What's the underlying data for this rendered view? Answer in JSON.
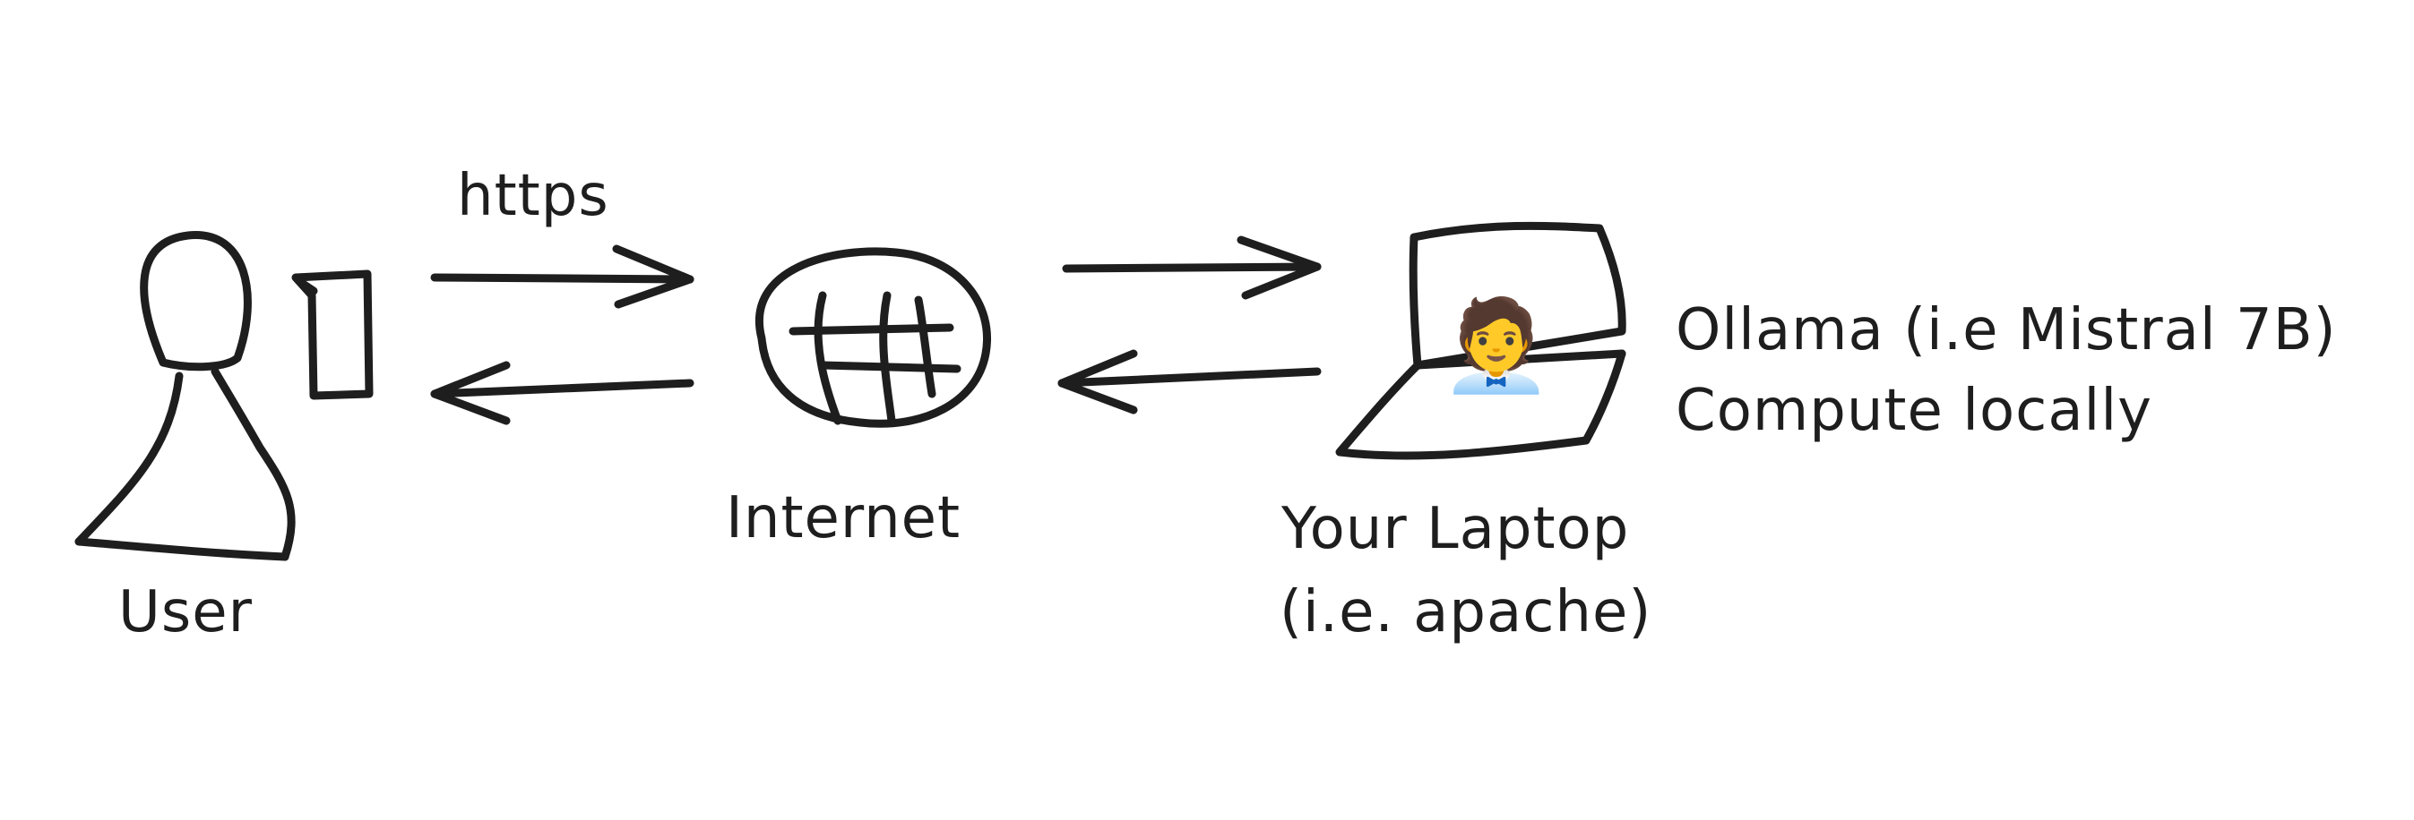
{
  "labels": {
    "protocol": "https",
    "user": "User",
    "internet": "Internet",
    "laptop_line1": "Your Laptop",
    "laptop_line2": "(i.e. apache)",
    "compute_line1": "Ollama (i.e Mistral 7B)",
    "compute_line2": "Compute locally"
  },
  "icons": {
    "user": "person-icon",
    "phone": "phone-icon",
    "internet": "globe-icon",
    "laptop": "laptop-icon",
    "laptop_screen": "office-worker-icon"
  },
  "glyphs": {
    "laptop_screen": "🧑‍💼"
  },
  "colors": {
    "stroke": "#1e1e1e",
    "background": "#ffffff"
  }
}
